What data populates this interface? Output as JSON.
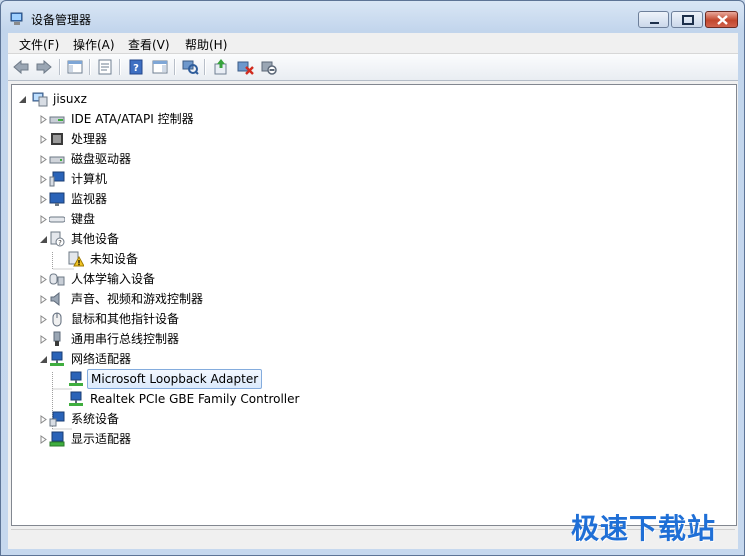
{
  "window": {
    "title": "设备管理器"
  },
  "menu": [
    "文件(F)",
    "操作(A)",
    "查看(V)",
    "帮助(H)"
  ],
  "toolbar": [
    "back-icon",
    "forward-icon",
    "show-hide-console-tree-icon",
    "properties-icon",
    "help-icon",
    "show-hide-action-pane-icon",
    "scan-hardware-icon",
    "update-driver-icon",
    "uninstall-icon",
    "disable-icon"
  ],
  "tree": {
    "root": "jisuxz",
    "items": [
      {
        "label": "IDE ATA/ATAPI 控制器",
        "icon": "ide-controller-icon",
        "level": 1,
        "state": "collapsed"
      },
      {
        "label": "处理器",
        "icon": "processor-icon",
        "level": 1,
        "state": "collapsed"
      },
      {
        "label": "磁盘驱动器",
        "icon": "disk-drive-icon",
        "level": 1,
        "state": "collapsed"
      },
      {
        "label": "计算机",
        "icon": "computer-icon",
        "level": 1,
        "state": "collapsed"
      },
      {
        "label": "监视器",
        "icon": "monitor-icon",
        "level": 1,
        "state": "collapsed"
      },
      {
        "label": "键盘",
        "icon": "keyboard-icon",
        "level": 1,
        "state": "collapsed"
      },
      {
        "label": "其他设备",
        "icon": "other-devices-icon",
        "level": 1,
        "state": "expanded"
      },
      {
        "label": "未知设备",
        "icon": "unknown-device-warning-icon",
        "level": 2,
        "state": "leaf"
      },
      {
        "label": "人体学输入设备",
        "icon": "hid-icon",
        "level": 1,
        "state": "collapsed"
      },
      {
        "label": "声音、视频和游戏控制器",
        "icon": "sound-icon",
        "level": 1,
        "state": "collapsed"
      },
      {
        "label": "鼠标和其他指针设备",
        "icon": "mouse-icon",
        "level": 1,
        "state": "collapsed"
      },
      {
        "label": "通用串行总线控制器",
        "icon": "usb-icon",
        "level": 1,
        "state": "collapsed"
      },
      {
        "label": "网络适配器",
        "icon": "network-adapter-icon",
        "level": 1,
        "state": "expanded"
      },
      {
        "label": "Microsoft Loopback Adapter",
        "icon": "network-adapter-icon",
        "level": 2,
        "state": "leaf",
        "selected": true
      },
      {
        "label": "Realtek PCIe GBE Family Controller",
        "icon": "network-adapter-icon",
        "level": 2,
        "state": "leaf"
      },
      {
        "label": "系统设备",
        "icon": "system-device-icon",
        "level": 1,
        "state": "collapsed"
      },
      {
        "label": "显示适配器",
        "icon": "display-adapter-icon",
        "level": 1,
        "state": "collapsed"
      }
    ]
  },
  "watermark": "极速下载站",
  "colors": {
    "selection_border": "#84acdd",
    "watermark": "#1f6fd6"
  }
}
